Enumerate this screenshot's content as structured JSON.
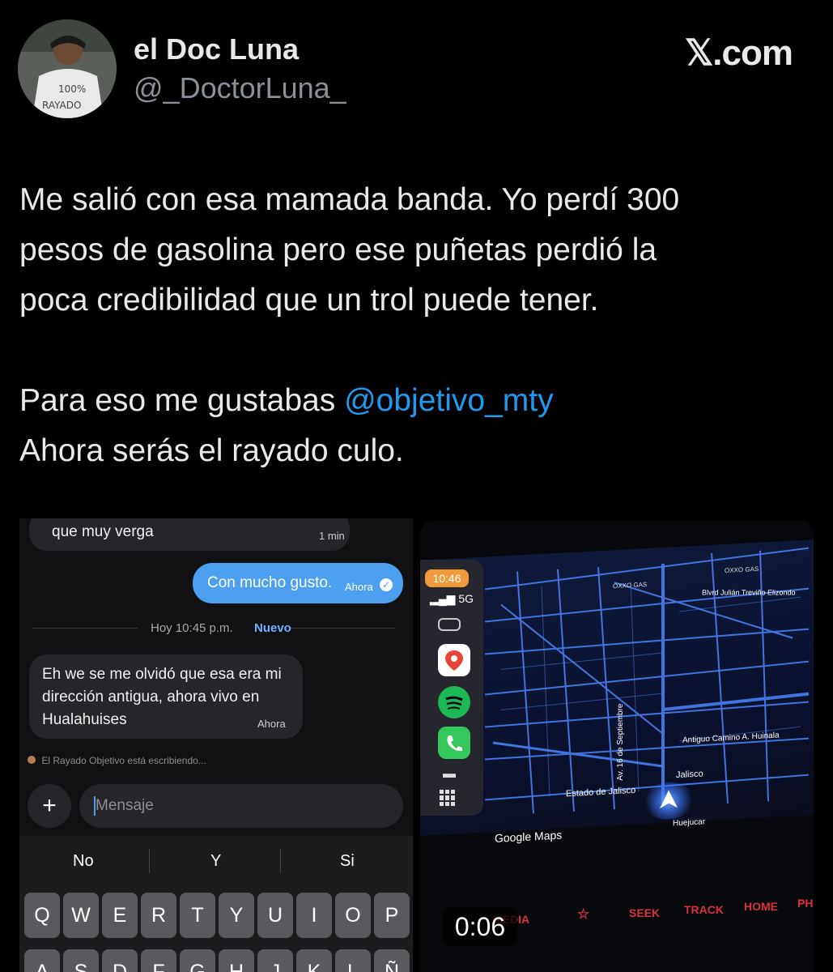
{
  "header": {
    "display_name": "el Doc Luna",
    "handle": "@_DoctorLuna_",
    "brand": "𝕏.com",
    "avatar_shirt_text": "100% RAYADO"
  },
  "tweet": {
    "line1": "Me salió con esa mamada banda. Yo perdí 300",
    "line2": "pesos de gasolina pero ese puñetas perdió la",
    "line3": "poca credibilidad que un trol puede tener.",
    "line4_prefix": "Para eso me gustabas ",
    "mention": "@objetivo_mty",
    "line5": "Ahora serás el rayado culo."
  },
  "chat": {
    "msg1_text": "que muy verga",
    "msg1_time": "1 min",
    "msg2_text": "Con mucho gusto.",
    "msg2_time": "Ahora",
    "divider_time": "Hoy 10:45 p.m.",
    "divider_new": "Nuevo",
    "msg3_line1": "Eh we se me olvidó que esa era mi",
    "msg3_line2": "dirección antigua, ahora vivo en",
    "msg3_line3": "Hualahuises",
    "msg3_time": "Ahora",
    "typing": "El Rayado Objetivo está escribiendo...",
    "input_placeholder": "Mensaje",
    "plus": "+",
    "suggestions": [
      "No",
      "Y",
      "Si"
    ],
    "keys_row1": [
      "Q",
      "W",
      "E",
      "R",
      "T",
      "Y",
      "U",
      "I",
      "O",
      "P"
    ],
    "keys_row2": [
      "A",
      "S",
      "D",
      "F",
      "G",
      "H",
      "J",
      "K",
      "L",
      "Ñ"
    ]
  },
  "carplay": {
    "clock": "10:46",
    "signal": "5G",
    "street1": "Blvrd Julián Treviño Elizondo",
    "street2": "Antiguo Camino A. Huinala",
    "street3": "Estado de Jalisco",
    "street4": "Jalisco",
    "street5": "Av. 16 de Septiembre",
    "street6": "Huejucar",
    "poi1": "OXXO GAS",
    "poi2": "OXXO GAS",
    "map_brand": "Google Maps",
    "dash_labels": [
      "MEDIA",
      "☆",
      "SEEK",
      "TRACK",
      "HOME",
      "PH"
    ],
    "video_duration": "0:06"
  },
  "colors": {
    "background": "#000000",
    "text": "#e7e9ea",
    "secondary": "#8b9096",
    "link": "#1d9bf0",
    "bubble_out": "#4d9ff0",
    "map_lines": "#4a86ff"
  }
}
